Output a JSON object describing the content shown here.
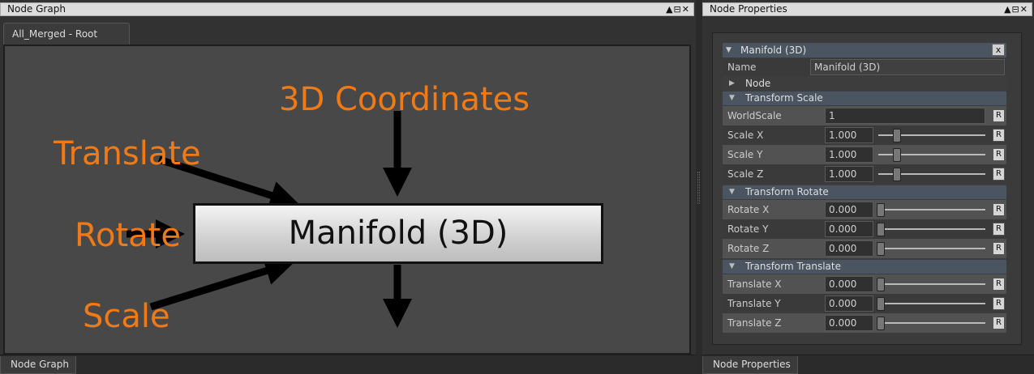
{
  "node_graph_panel": {
    "title": "Node Graph",
    "window_controls": "▲⊟✕",
    "doc_tab": "All_Merged - Root",
    "bottom_tab": "Node Graph",
    "labels": {
      "coords": "3D Coordinates",
      "translate": "Translate",
      "rotate": "Rotate",
      "scale": "Scale"
    },
    "node_name": "Manifold (3D)",
    "label_color": "#ef7a18"
  },
  "properties_panel": {
    "title": "Node Properties",
    "window_controls": "▲⊟✕",
    "bottom_tab": "Node Properties",
    "node_header": "Manifold (3D)",
    "close_label": "x",
    "name_label": "Name",
    "name_value": "Manifold (3D)",
    "groups": {
      "node": "Node",
      "scale": "Transform Scale",
      "rotate": "Transform Rotate",
      "translate": "Transform Translate"
    },
    "reset_label": "R",
    "fields": {
      "worldscale": {
        "label": "WorldScale",
        "value": "1"
      },
      "scale_x": {
        "label": "Scale X",
        "value": "1.000"
      },
      "scale_y": {
        "label": "Scale Y",
        "value": "1.000"
      },
      "scale_z": {
        "label": "Scale Z",
        "value": "1.000"
      },
      "rotate_x": {
        "label": "Rotate X",
        "value": "0.000"
      },
      "rotate_y": {
        "label": "Rotate Y",
        "value": "0.000"
      },
      "rotate_z": {
        "label": "Rotate Z",
        "value": "0.000"
      },
      "translate_x": {
        "label": "Translate X",
        "value": "0.000"
      },
      "translate_y": {
        "label": "Translate Y",
        "value": "0.000"
      },
      "translate_z": {
        "label": "Translate Z",
        "value": "0.000"
      }
    }
  }
}
